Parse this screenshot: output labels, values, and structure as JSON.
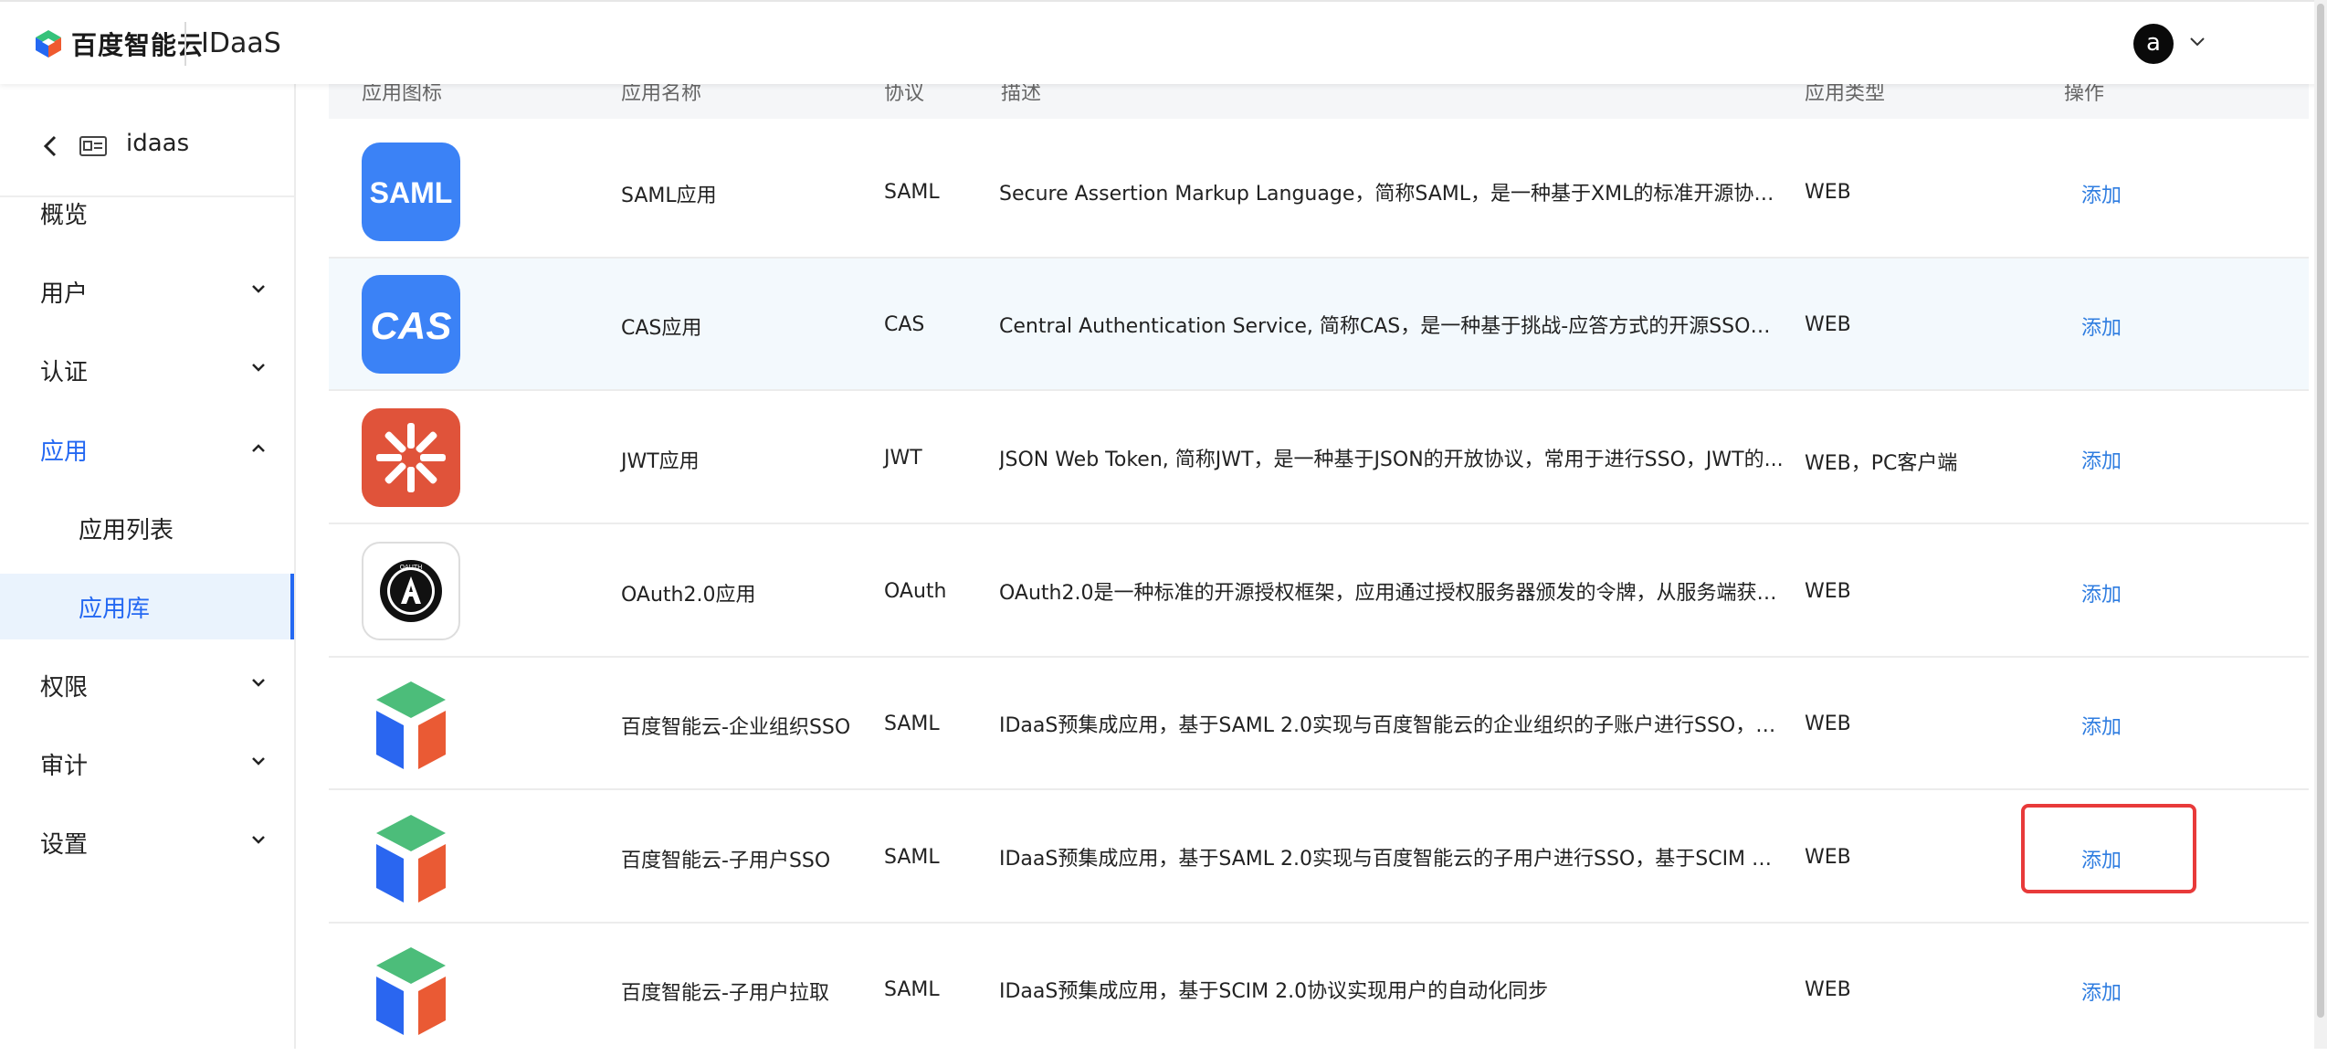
{
  "header": {
    "brand": "百度智能云",
    "product": "IDaaS",
    "avatar_letter": "a"
  },
  "sidebar": {
    "app_name": "idaas",
    "items": [
      {
        "label": "概览"
      },
      {
        "label": "用户"
      },
      {
        "label": "认证"
      },
      {
        "label": "应用"
      },
      {
        "label": "权限"
      },
      {
        "label": "审计"
      },
      {
        "label": "设置"
      }
    ],
    "sub_items": [
      {
        "label": "应用列表"
      },
      {
        "label": "应用库"
      }
    ]
  },
  "table": {
    "columns": [
      "应用图标",
      "应用名称",
      "协议",
      "描述",
      "应用类型",
      "操作"
    ],
    "rows": [
      {
        "icon": "saml-icon",
        "name": "SAML应用",
        "protocol": "SAML",
        "desc": "Secure Assertion Markup Language，简称SAML，是一种基于XML的标准开源协议，...",
        "type": "WEB",
        "action": "添加"
      },
      {
        "icon": "cas-icon",
        "name": "CAS应用",
        "protocol": "CAS",
        "desc": "Central Authentication Service, 简称CAS，是一种基于挑战-应答方式的开源SSO协议...",
        "type": "WEB",
        "action": "添加"
      },
      {
        "icon": "jwt-icon",
        "name": "JWT应用",
        "protocol": "JWT",
        "desc": "JSON Web Token, 简称JWT，是一种基于JSON的开放协议，常用于进行SSO，JWT的...",
        "type": "WEB，PC客户端",
        "action": "添加"
      },
      {
        "icon": "oauth-icon",
        "name": "OAuth2.0应用",
        "protocol": "OAuth",
        "desc": "OAuth2.0是一种标准的开源授权框架，应用通过授权服务器颁发的令牌，从服务端获取...",
        "type": "WEB",
        "action": "添加"
      },
      {
        "icon": "baidu-cloud-icon",
        "name": "百度智能云-企业组织SSO",
        "protocol": "SAML",
        "desc": "IDaaS预集成应用，基于SAML 2.0实现与百度智能云的企业组织的子账户进行SSO，基...",
        "type": "WEB",
        "action": "添加"
      },
      {
        "icon": "baidu-cloud-icon",
        "name": "百度智能云-子用户SSO",
        "protocol": "SAML",
        "desc": "IDaaS预集成应用，基于SAML 2.0实现与百度智能云的子用户进行SSO，基于SCIM 2.0...",
        "type": "WEB",
        "action": "添加"
      },
      {
        "icon": "baidu-cloud-icon",
        "name": "百度智能云-子用户拉取",
        "protocol": "SAML",
        "desc": "IDaaS预集成应用，基于SCIM 2.0协议实现用户的自动化同步",
        "type": "WEB",
        "action": "添加"
      }
    ],
    "icon_texts": {
      "saml": "SAML",
      "cas": "CAS",
      "oauth_ring": "OAUTH"
    }
  },
  "colors": {
    "accent": "#2468f2",
    "link": "#2f7de0",
    "highlight": "#e83a3a",
    "saml_bg": "#3b82f6",
    "jwt_bg": "#e0533a"
  }
}
